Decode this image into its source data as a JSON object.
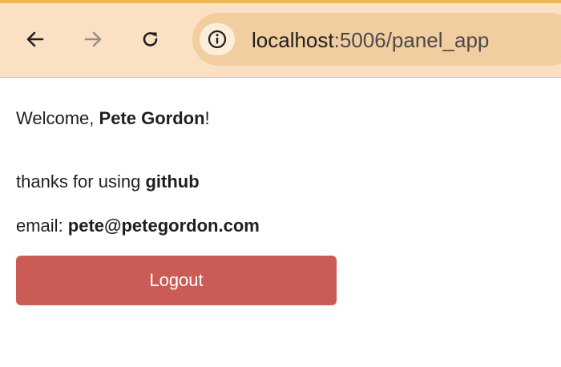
{
  "browser": {
    "url_host": "localhost",
    "url_rest": ":5006/panel_app",
    "icons": {
      "back": "back-arrow-icon",
      "forward": "forward-arrow-icon",
      "reload": "reload-icon",
      "info": "info-icon"
    },
    "colors": {
      "toolbar": "#fbe1c4",
      "omnibox": "#f2cda0",
      "accent": "#f2b45a"
    }
  },
  "page": {
    "welcome_prefix": "Welcome, ",
    "user_name": "Pete Gordon",
    "welcome_suffix": "!",
    "thanks_prefix": "thanks for using ",
    "provider": "github",
    "email_prefix": "email: ",
    "email": "pete@petegordon.com",
    "logout_label": "Logout",
    "logout_color": "#cb5c55"
  }
}
